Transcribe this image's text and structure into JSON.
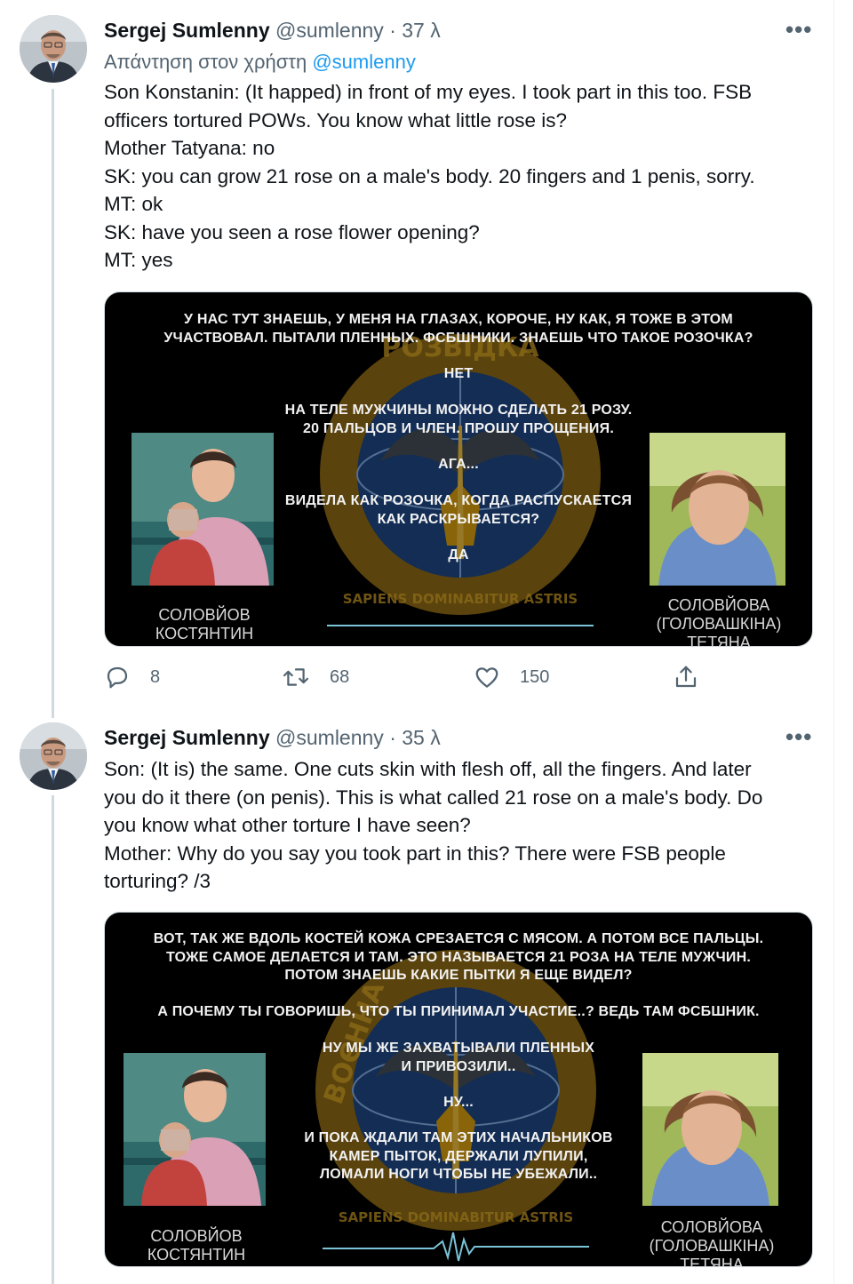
{
  "tweets": [
    {
      "author": "Sergej Sumlenny",
      "handle": "@sumlenny",
      "time": "· 37 λ",
      "reply_prefix": "Απάντηση στον χρήστη",
      "reply_handle": "@sumlenny",
      "body_lines": [
        "Son Konstanin: (It happed) in front of my eyes. I took part in this too. FSB",
        "officers tortured POWs. You know what little rose is?",
        "Mother Tatyana: no",
        "SK: you can grow 21 rose on a male's body. 20 fingers and 1 penis, sorry.",
        "MT: ok",
        "SK: have you seen a rose flower opening?",
        "MT: yes"
      ],
      "media": {
        "subtitle_lines": [
          "У НАС ТУТ ЗНАЕШЬ, У МЕНЯ НА ГЛАЗАХ, КОРОЧЕ, НУ КАК, Я ТОЖЕ В ЭТОМ",
          "УЧАСТВОВАЛ. ПЫТАЛИ ПЛЕННЫХ. ФСБШНИКИ. ЗНАЕШЬ ЧТО ТАКОЕ РОЗОЧКА?",
          "НЕТ",
          "НА ТЕЛЕ МУЖЧИНЫ МОЖНО СДЕЛАТЬ 21 РОЗУ.",
          "20 ПАЛЬЦОВ И ЧЛЕН. ПРОШУ ПРОЩЕНИЯ.",
          "АГА...",
          "ВИДЕЛА КАК РОЗОЧКА, КОГДА РАСПУСКАЕТСЯ",
          "КАК РАСКРЫВАЕТСЯ?",
          "ДА"
        ],
        "name_left": [
          "СОЛОВЙОВ",
          "КОСТЯНТИН"
        ],
        "name_right": [
          "СОЛОВЙОВА",
          "(ГОЛОВАШКІНА)",
          "ТЕТЯНА"
        ],
        "emblem_top": "РОЗВІДКА",
        "emblem_motto": "SAPIENS DOMINABITUR ASTRIS"
      },
      "stats": {
        "replies": "8",
        "retweets": "68",
        "likes": "150"
      }
    },
    {
      "author": "Sergej Sumlenny",
      "handle": "@sumlenny",
      "time": "· 35 λ",
      "body_lines": [
        "Son: (It is) the same. One cuts skin with flesh off, all the fingers. And later",
        "you do it there (on penis). This is what called 21 rose on a male's body. Do",
        "you know what other torture I have seen?",
        "Mother: Why do you say you took part in this? There were FSB people",
        "torturing? /3"
      ],
      "media": {
        "subtitle_lines": [
          "ВОТ, ТАК ЖЕ ВДОЛЬ КОСТЕЙ КОЖА СРЕЗАЕТСЯ С МЯСОМ. А ПОТОМ ВСЕ ПАЛЬЦЫ.",
          "ТОЖЕ САМОЕ ДЕЛАЕТСЯ И ТАМ.  ЭТО НАЗЫВАЕТСЯ 21 РОЗА НА ТЕЛЕ МУЖЧИН.",
          "ПОТОМ ЗНАЕШЬ КАКИЕ ПЫТКИ Я ЕЩЕ ВИДЕЛ?",
          "А ПОЧЕМУ ТЫ ГОВОРИШЬ, ЧТО ТЫ ПРИНИМАЛ УЧАСТИЕ..? ВЕДЬ ТАМ ФСБШНИК.",
          "НУ МЫ ЖЕ ЗАХВАТЫВАЛИ ПЛЕННЫХ",
          "И ПРИВОЗИЛИ..",
          "НУ...",
          "И ПОКА ЖДАЛИ ТАМ ЭТИХ НАЧАЛЬНИКОВ",
          "КАМЕР ПЫТОК, ДЕРЖАЛИ ЛУПИЛИ,",
          "ЛОМАЛИ НОГИ ЧТОБЫ НЕ УБЕЖАЛИ.."
        ],
        "name_left": [
          "СОЛОВЙОВ",
          "КОСТЯНТИН"
        ],
        "name_right": [
          "СОЛОВЙОВА",
          "(ГОЛОВАШКІНА)",
          "ТЕТЯНА"
        ],
        "emblem_top": "ВОЄННА",
        "emblem_motto": "SAPIENS DOMINABITUR ASTRIS"
      }
    }
  ],
  "colors": {
    "link": "#1d9bf0",
    "muted": "#536471",
    "text": "#0f1419",
    "emblem_gold": "#b8860b",
    "emblem_blue": "#1f4a8a"
  },
  "icons": [
    "reply-icon",
    "retweet-icon",
    "like-icon",
    "share-icon",
    "more-icon"
  ]
}
